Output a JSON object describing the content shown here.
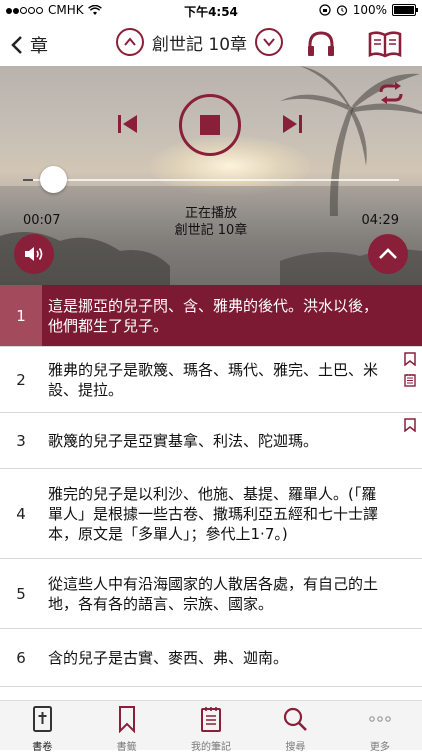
{
  "status_bar": {
    "carrier": "CMHK",
    "time": "下午4:54",
    "battery": "100%"
  },
  "nav": {
    "back_label": "章",
    "title": "創世記 10章"
  },
  "player": {
    "elapsed": "00:07",
    "total": "04:29",
    "status_line1": "正在播放",
    "status_line2": "創世記  10章",
    "progress": 0.026
  },
  "verses": [
    {
      "num": "1",
      "text": "這是挪亞的兒子閃、含、雅弗的後代。洪水以後，他們都生了兒子。",
      "active": true,
      "marks": []
    },
    {
      "num": "2",
      "text": "雅弗的兒子是歌篾、瑪各、瑪代、雅完、土巴、米設、提拉。",
      "active": false,
      "marks": [
        "bookmark",
        "note"
      ]
    },
    {
      "num": "3",
      "text": "歌篾的兒子是亞實基拿、利法、陀迦瑪。",
      "active": false,
      "marks": [
        "bookmark"
      ]
    },
    {
      "num": "4",
      "text": "雅完的兒子是以利沙、他施、基提、羅單人。(「羅單人」是根據一些古卷、撒瑪利亞五經和七十士譯本，原文是「多單人」；參代上1·7。)",
      "active": false,
      "marks": []
    },
    {
      "num": "5",
      "text": "從這些人中有沿海國家的人散居各處，有自己的土地，各有各的語言、宗族、國家。",
      "active": false,
      "marks": []
    },
    {
      "num": "6",
      "text": "含的兒子是古實、麥西、弗、迦南。",
      "active": false,
      "marks": []
    }
  ],
  "tabs": [
    {
      "label": "書卷",
      "icon": "bible-icon",
      "active": true
    },
    {
      "label": "書籤",
      "icon": "bookmark-icon",
      "active": false
    },
    {
      "label": "我的筆記",
      "icon": "notes-icon",
      "active": false
    },
    {
      "label": "搜尋",
      "icon": "search-icon",
      "active": false
    },
    {
      "label": "更多",
      "icon": "more-icon",
      "active": false
    }
  ],
  "colors": {
    "accent": "#8a1f3a",
    "active_row": "#7b1a32",
    "active_number": "#a34b5d"
  }
}
